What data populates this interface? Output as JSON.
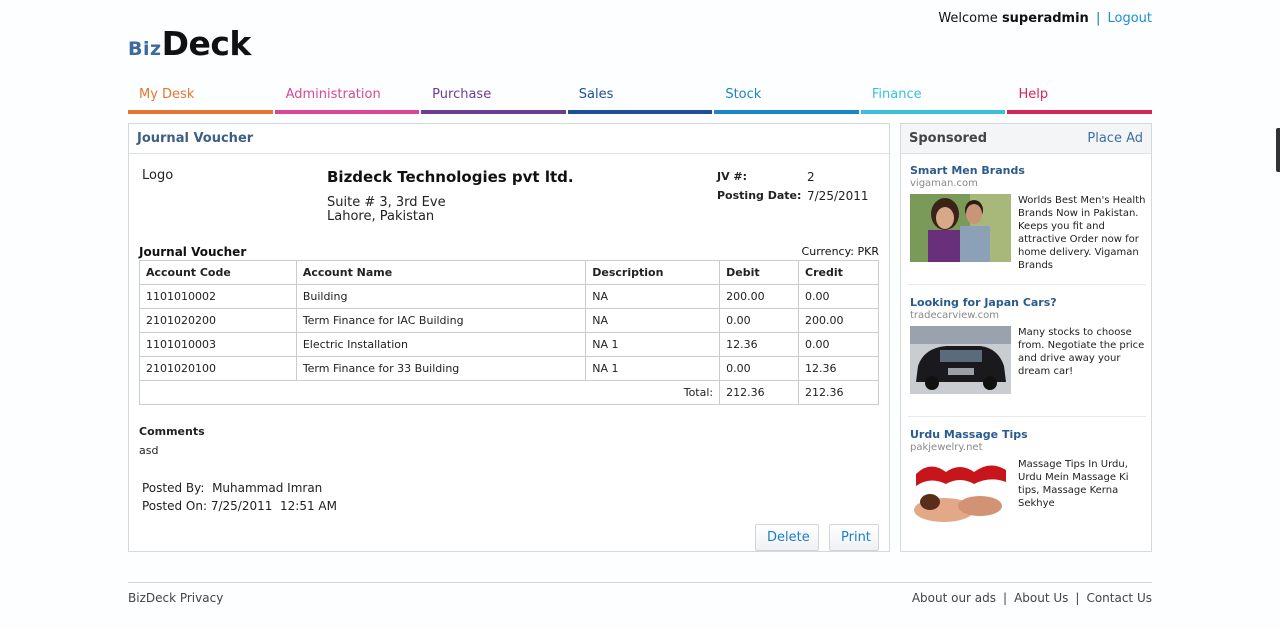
{
  "header": {
    "welcome_prefix": "Welcome",
    "username": "superadmin",
    "separator": "|",
    "logout": "Logout",
    "logo_biz": "Biz",
    "logo_deck": "Deck"
  },
  "nav": [
    {
      "label": "My Desk",
      "color": "#e2782f"
    },
    {
      "label": "Administration",
      "color": "#d9479a"
    },
    {
      "label": "Purchase",
      "color": "#6b3e94"
    },
    {
      "label": "Sales",
      "color": "#1d4f96"
    },
    {
      "label": "Stock",
      "color": "#1b86c3"
    },
    {
      "label": "Finance",
      "color": "#3cc0d9"
    },
    {
      "label": "Help",
      "color": "#d62654"
    }
  ],
  "voucher": {
    "panel_title": "Journal Voucher",
    "logo_text": "Logo",
    "company_name": "Bizdeck Technologies pvt ltd.",
    "address_line1": "Suite # 3, 3rd Eve",
    "address_line2": "Lahore, Pakistan",
    "jv_label": "JV #:",
    "jv_value": "2",
    "posting_label": "Posting Date:",
    "posting_value": "7/25/2011",
    "section_title": "Journal Voucher",
    "currency": "Currency: PKR",
    "columns": [
      "Account Code",
      "Account Name",
      "Description",
      "Debit",
      "Credit"
    ],
    "rows": [
      [
        "1101010002",
        "Building",
        "NA",
        "200.00",
        "0.00"
      ],
      [
        "2101020200",
        "Term Finance for IAC Building",
        "NA",
        "0.00",
        "200.00"
      ],
      [
        "1101010003",
        "Electric Installation",
        "NA 1",
        "12.36",
        "0.00"
      ],
      [
        "2101020100",
        "Term Finance for 33 Building",
        "NA 1",
        "0.00",
        "12.36"
      ]
    ],
    "total_label": "Total:",
    "total_debit": "212.36",
    "total_credit": "212.36",
    "comments_label": "Comments",
    "comments_value": "asd",
    "posted_by_label": "Posted By:",
    "posted_by_value": "Muhammad Imran",
    "posted_on_label": "Posted On:",
    "posted_on_value": "7/25/2011  12:51 AM",
    "delete_button": "Delete",
    "print_button": "Print"
  },
  "sponsored": {
    "title": "Sponsored",
    "place_ad": "Place Ad",
    "ads": [
      {
        "title": "Smart Men Brands",
        "domain": "vigaman.com",
        "text": "Worlds Best Men's Health Brands Now in Pakistan. Keeps you fit and attractive Order now for home delivery. Vigaman Brands"
      },
      {
        "title": "Looking for Japan Cars?",
        "domain": "tradecarview.com",
        "text": "Many stocks to choose from. Negotiate the price and drive away your dream car!"
      },
      {
        "title": "Urdu Massage Tips",
        "domain": "pakjewelry.net",
        "text": "Massage Tips In Urdu, Urdu Mein Massage Ki tips, Massage Kerna Sekhye"
      }
    ]
  },
  "footer": {
    "left": "BizDeck Privacy",
    "links": [
      "About our ads",
      "About Us",
      "Contact Us"
    ],
    "separator": "|"
  }
}
